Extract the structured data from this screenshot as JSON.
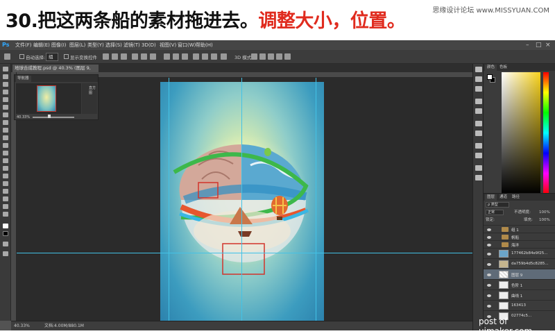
{
  "banner": {
    "title_main": "30.把这两条船的素材拖进去。",
    "title_highlight": "调整大小，位置。",
    "site": "思缘设计论坛 www.MISSYUAN.COM"
  },
  "app": {
    "logo": "Ps",
    "menus": [
      "文件(F)",
      "编辑(E)",
      "图像(I)",
      "图层(L)",
      "类型(Y)",
      "选择(S)",
      "滤镜(T)",
      "3D(D)",
      "视图(V)",
      "窗口(W)",
      "帮助(H)"
    ],
    "window_controls": [
      "–",
      "□",
      "×"
    ]
  },
  "options_bar": {
    "auto_select_label": "自动选择:",
    "auto_select_value": "组",
    "show_transform_label": "显示变换控件",
    "mode_3d_label": "3D 模式:"
  },
  "document": {
    "tab_title": "地球合成教程.psd @ 40.3% (图层 9, RGB/8) *",
    "zoom_status": "40.33%",
    "doc_status": "文档:4.00M/880.1M"
  },
  "navigator": {
    "tab": "导航器",
    "zoom": "40.33%",
    "side_label": "直方图"
  },
  "color_panel": {
    "tabs": [
      "颜色",
      "色板"
    ],
    "accent": "#f9d31d"
  },
  "layers_panel": {
    "tabs": [
      "图层",
      "通道",
      "路径"
    ],
    "filter_label": "ρ 类型",
    "blend_mode": "正常",
    "opacity_label": "不透明度:",
    "opacity": "100%",
    "lock_label": "锁定:",
    "fill_label": "填充:",
    "fill": "100%",
    "layers": [
      {
        "name": "组 1",
        "type": "group"
      },
      {
        "name": "帆船",
        "type": "group"
      },
      {
        "name": "海洋",
        "type": "group"
      },
      {
        "name": "177462b84e9f25...",
        "type": "image"
      },
      {
        "name": "da759b4d5c8285...",
        "type": "image"
      },
      {
        "name": "图层 9",
        "type": "image",
        "selected": true
      },
      {
        "name": "色阶 1",
        "type": "adjustment"
      },
      {
        "name": "曲线 1",
        "type": "adjustment"
      },
      {
        "name": "163413",
        "type": "image"
      },
      {
        "name": "02774c5...",
        "type": "image"
      }
    ]
  },
  "watermark": "post of uimaker.com"
}
